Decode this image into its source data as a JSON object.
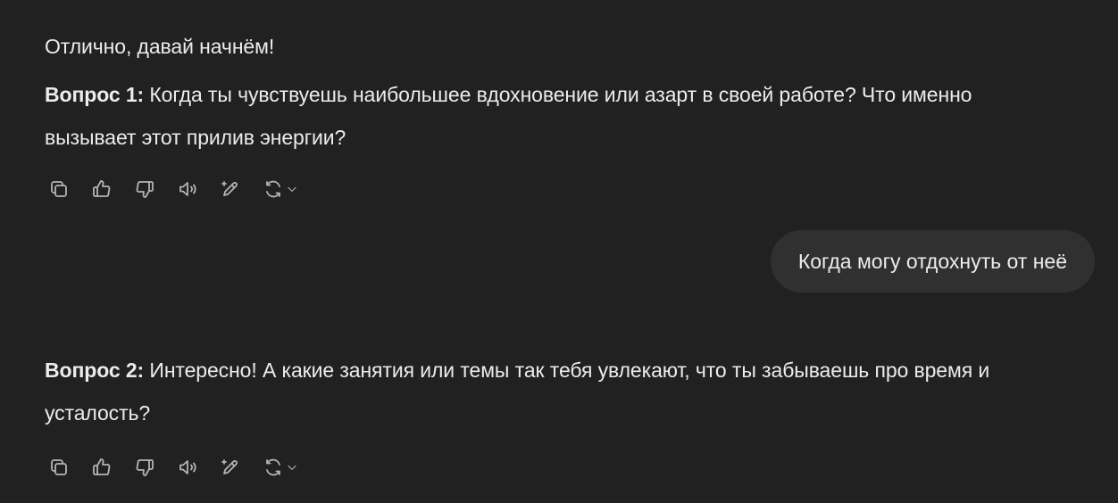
{
  "assistant_message_1": {
    "intro": "Отлично, давай начнём!",
    "question_label": "Вопрос 1:",
    "question_text": " Когда ты чувствуешь наибольшее вдохновение или азарт в своей работе? Что именно вызывает этот прилив энергии?"
  },
  "user_message": {
    "text": "Когда могу отдохнуть от неё"
  },
  "assistant_message_2": {
    "question_label": "Вопрос 2:",
    "question_text": " Интересно! А какие занятия или темы так тебя увлекают, что ты забываешь про время и усталость?"
  },
  "actions": [
    {
      "icon": "copy-icon"
    },
    {
      "icon": "thumbs-up-icon"
    },
    {
      "icon": "thumbs-down-icon"
    },
    {
      "icon": "read-aloud-icon"
    },
    {
      "icon": "edit-sparkle-icon"
    },
    {
      "icon": "regenerate-icon"
    },
    {
      "icon": "chevron-down-icon"
    }
  ],
  "colors": {
    "background": "#212121",
    "text": "#ececec",
    "icon": "#b4b4b4",
    "user_bubble": "#303030"
  }
}
